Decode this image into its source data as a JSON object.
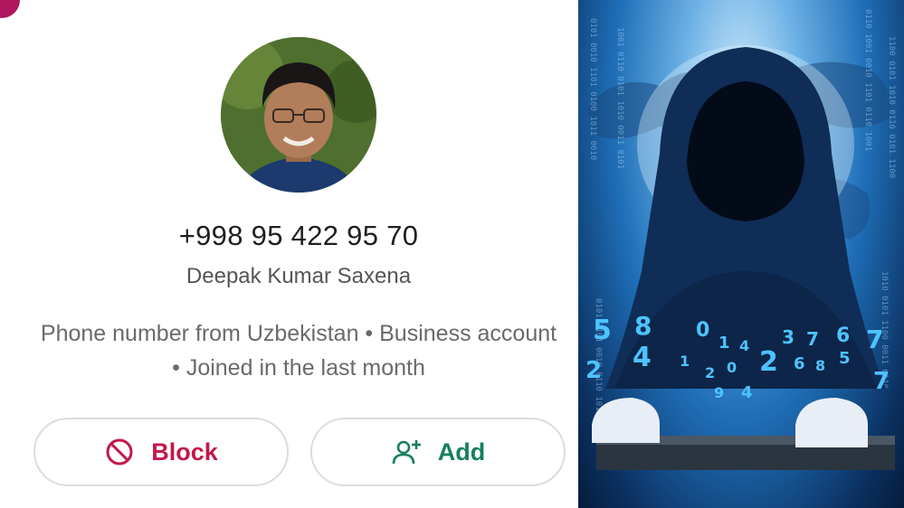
{
  "contact": {
    "phone": "+998 95 422 95 70",
    "name": "Deepak Kumar Saxena",
    "info": "Phone number from Uzbekistan • Business account • Joined in the last month"
  },
  "actions": {
    "block_label": "Block",
    "add_label": "Add"
  },
  "colors": {
    "block": "#c2184b",
    "add": "#17805a",
    "accent": "#b0175f"
  },
  "illustration": {
    "digits": [
      "5",
      "8",
      "0",
      "1",
      "4",
      "3",
      "7",
      "6",
      "7",
      "2",
      "4",
      "1",
      "2",
      "0",
      "2",
      "6",
      "8",
      "5",
      "7",
      "9",
      "4"
    ]
  }
}
